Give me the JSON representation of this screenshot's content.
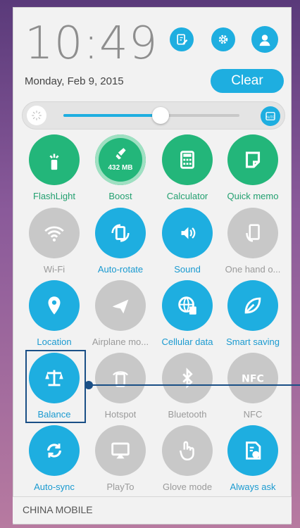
{
  "status": {
    "time": "10:49",
    "date": "Monday, Feb 9, 2015"
  },
  "top_icons": [
    {
      "name": "edit-icon",
      "color": "#1eaee0"
    },
    {
      "name": "settings-gear-icon",
      "color": "#1eaee0"
    },
    {
      "name": "user-avatar-icon",
      "color": "#1eaee0"
    }
  ],
  "clear_label": "Clear",
  "brightness": {
    "level_percent": 55,
    "auto_icon": "brightness-auto-icon",
    "sun_icon": "brightness-sun-icon"
  },
  "quick_settings": [
    {
      "label": "FlashLight",
      "state": "green",
      "icon": "flashlight-icon"
    },
    {
      "label": "Boost",
      "state": "green",
      "icon": "boost-icon",
      "badge": "432 MB"
    },
    {
      "label": "Calculator",
      "state": "green",
      "icon": "calculator-icon"
    },
    {
      "label": "Quick memo",
      "state": "green",
      "icon": "memo-icon"
    },
    {
      "label": "Wi-Fi",
      "state": "gray",
      "icon": "wifi-icon"
    },
    {
      "label": "Auto-rotate",
      "state": "blue",
      "icon": "rotate-icon"
    },
    {
      "label": "Sound",
      "state": "blue",
      "icon": "sound-icon"
    },
    {
      "label": "One hand o...",
      "state": "gray",
      "icon": "one-hand-icon"
    },
    {
      "label": "Location",
      "state": "blue",
      "icon": "location-icon"
    },
    {
      "label": "Airplane mo...",
      "state": "gray",
      "icon": "airplane-icon"
    },
    {
      "label": "Cellular data",
      "state": "blue",
      "icon": "cellular-data-icon"
    },
    {
      "label": "Smart saving",
      "state": "blue",
      "icon": "leaf-icon"
    },
    {
      "label": "Balance",
      "state": "blue",
      "icon": "balance-scale-icon"
    },
    {
      "label": "Hotspot",
      "state": "gray",
      "icon": "hotspot-icon"
    },
    {
      "label": "Bluetooth",
      "state": "gray",
      "icon": "bluetooth-icon"
    },
    {
      "label": "NFC",
      "state": "gray",
      "icon": "nfc-icon"
    },
    {
      "label": "Auto-sync",
      "state": "blue",
      "icon": "sync-icon"
    },
    {
      "label": "PlayTo",
      "state": "gray",
      "icon": "playto-icon"
    },
    {
      "label": "Glove mode",
      "state": "gray",
      "icon": "glove-icon"
    },
    {
      "label": "Always ask",
      "state": "blue",
      "icon": "sim-ask-icon"
    }
  ],
  "carrier": "CHINA MOBILE",
  "colors": {
    "accent_blue": "#1eaee0",
    "accent_green": "#23b67a",
    "inactive_gray": "#c8c8c8",
    "annotation": "#1a4f86"
  }
}
